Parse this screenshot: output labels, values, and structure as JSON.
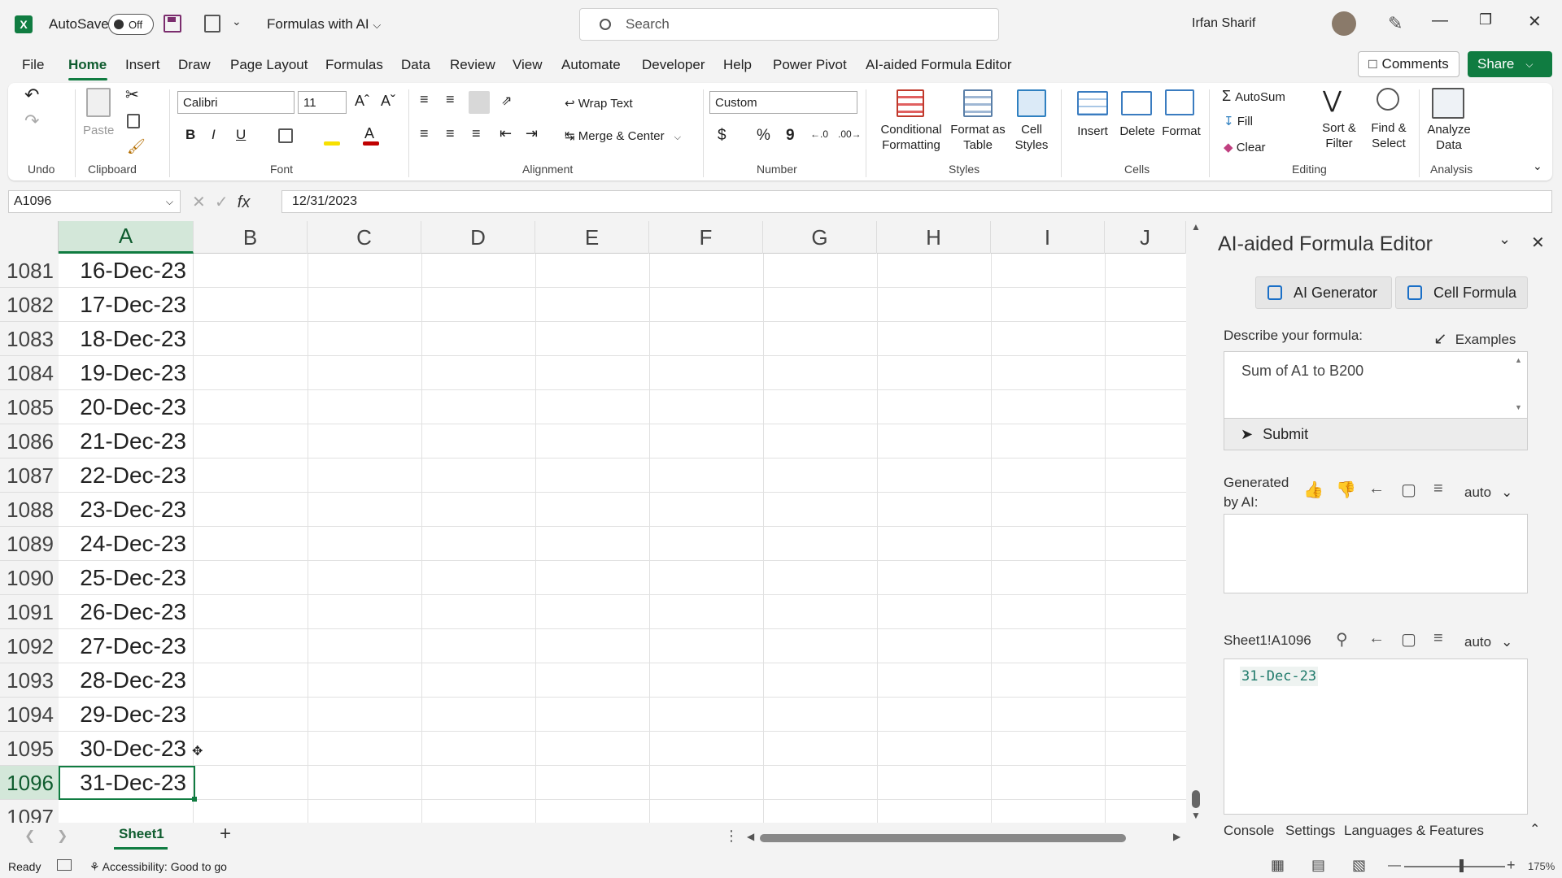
{
  "title_bar": {
    "app_icon": "X",
    "autosave_label": "AutoSave",
    "autosave_state": "Off",
    "doc_title": "Formulas with AI",
    "search_placeholder": "Search",
    "user_name": "Irfan Sharif"
  },
  "tabs": [
    "File",
    "Home",
    "Insert",
    "Draw",
    "Page Layout",
    "Formulas",
    "Data",
    "Review",
    "View",
    "Automate",
    "Developer",
    "Help",
    "Power Pivot",
    "AI-aided Formula Editor"
  ],
  "header_buttons": {
    "comments": "Comments",
    "share": "Share"
  },
  "ribbon": {
    "undo_label": "Undo",
    "paste": "Paste",
    "clipboard": "Clipboard",
    "font_name": "Calibri",
    "font_size": "11",
    "font_group": "Font",
    "bold": "B",
    "italic": "I",
    "underline": "U",
    "wrap_text": "Wrap Text",
    "merge_center": "Merge & Center",
    "alignment": "Alignment",
    "number_format": "Custom",
    "currency": "$",
    "percent": "%",
    "comma": "9",
    "number": "Number",
    "cond_format": [
      "Conditional",
      "Formatting"
    ],
    "format_table": [
      "Format as",
      "Table"
    ],
    "cell_styles": [
      "Cell",
      "Styles"
    ],
    "styles": "Styles",
    "insert": "Insert",
    "delete": "Delete",
    "format": "Format",
    "cells": "Cells",
    "autosum": "AutoSum",
    "fill": "Fill",
    "clear": "Clear",
    "sort_filter": [
      "Sort &",
      "Filter"
    ],
    "find_select": [
      "Find &",
      "Select"
    ],
    "editing": "Editing",
    "analyze": [
      "Analyze",
      "Data"
    ],
    "analysis": "Analysis"
  },
  "formula_bar": {
    "name_box": "A1096",
    "fx": "fx",
    "formula": "12/31/2023"
  },
  "columns": [
    "A",
    "B",
    "C",
    "D",
    "E",
    "F",
    "G",
    "H",
    "I",
    "J"
  ],
  "rows": [
    {
      "num": "1081",
      "a": "16-Dec-23"
    },
    {
      "num": "1082",
      "a": "17-Dec-23"
    },
    {
      "num": "1083",
      "a": "18-Dec-23"
    },
    {
      "num": "1084",
      "a": "19-Dec-23"
    },
    {
      "num": "1085",
      "a": "20-Dec-23"
    },
    {
      "num": "1086",
      "a": "21-Dec-23"
    },
    {
      "num": "1087",
      "a": "22-Dec-23"
    },
    {
      "num": "1088",
      "a": "23-Dec-23"
    },
    {
      "num": "1089",
      "a": "24-Dec-23"
    },
    {
      "num": "1090",
      "a": "25-Dec-23"
    },
    {
      "num": "1091",
      "a": "26-Dec-23"
    },
    {
      "num": "1092",
      "a": "27-Dec-23"
    },
    {
      "num": "1093",
      "a": "28-Dec-23"
    },
    {
      "num": "1094",
      "a": "29-Dec-23"
    },
    {
      "num": "1095",
      "a": "30-Dec-23"
    },
    {
      "num": "1096",
      "a": "31-Dec-23"
    },
    {
      "num": "1097",
      "a": ""
    }
  ],
  "sheet_tabs": {
    "active": "Sheet1",
    "add": "+"
  },
  "status": {
    "ready": "Ready",
    "accessibility": "Accessibility: Good to go",
    "zoom": "175%"
  },
  "panel": {
    "title": "AI-aided Formula Editor",
    "ai_generator": "AI Generator",
    "cell_formula": "Cell Formula",
    "describe_label": "Describe your formula:",
    "examples": "Examples",
    "prompt_text": "Sum of A1 to B200",
    "submit": "Submit",
    "generated_label": [
      "Generated",
      "by AI:"
    ],
    "auto": "auto",
    "cell_ref": "Sheet1!A1096",
    "cell_value": "31-Dec-23",
    "bottom_tabs": [
      "Console",
      "Settings",
      "Languages & Features"
    ]
  },
  "colors": {
    "accent": "#107c41",
    "panel_bg": "#f3f3f3",
    "code_green": "#1f7a6b"
  }
}
